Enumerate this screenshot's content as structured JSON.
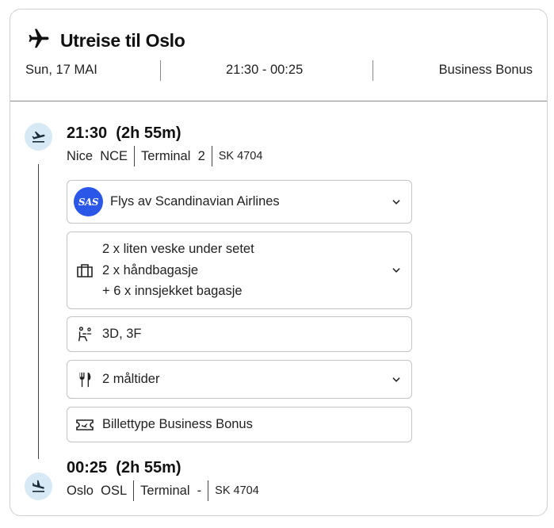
{
  "header": {
    "title": "Utreise til Oslo",
    "date": "Sun, 17 MAI",
    "time_range": "21:30 - 00:25",
    "fare_type": "Business Bonus"
  },
  "departure": {
    "time": "21:30",
    "duration": "(2h 55m)",
    "city": "Nice",
    "airport_code": "NCE",
    "terminal_label": "Terminal",
    "terminal": "2",
    "flight_number": "SK 4704"
  },
  "details": {
    "airline": {
      "logo_text": "SAS",
      "label": "Flys av Scandinavian Airlines"
    },
    "baggage": {
      "line1": "2 x liten veske under setet",
      "line2": "2 x håndbagasje",
      "line3": "+ 6 x innsjekket bagasje"
    },
    "seats": "3D, 3F",
    "meals": "2 måltider",
    "ticket": "Billettype Business Bonus"
  },
  "arrival": {
    "time": "00:25",
    "duration": "(2h 55m)",
    "city": "Oslo",
    "airport_code": "OSL",
    "terminal_label": "Terminal",
    "terminal": "-",
    "flight_number": "SK 4704"
  },
  "colors": {
    "icon_bg": "#d6e9f5",
    "sas_blue": "#2a57e8",
    "border": "#c4c4c4",
    "text": "#1a1a1a"
  }
}
